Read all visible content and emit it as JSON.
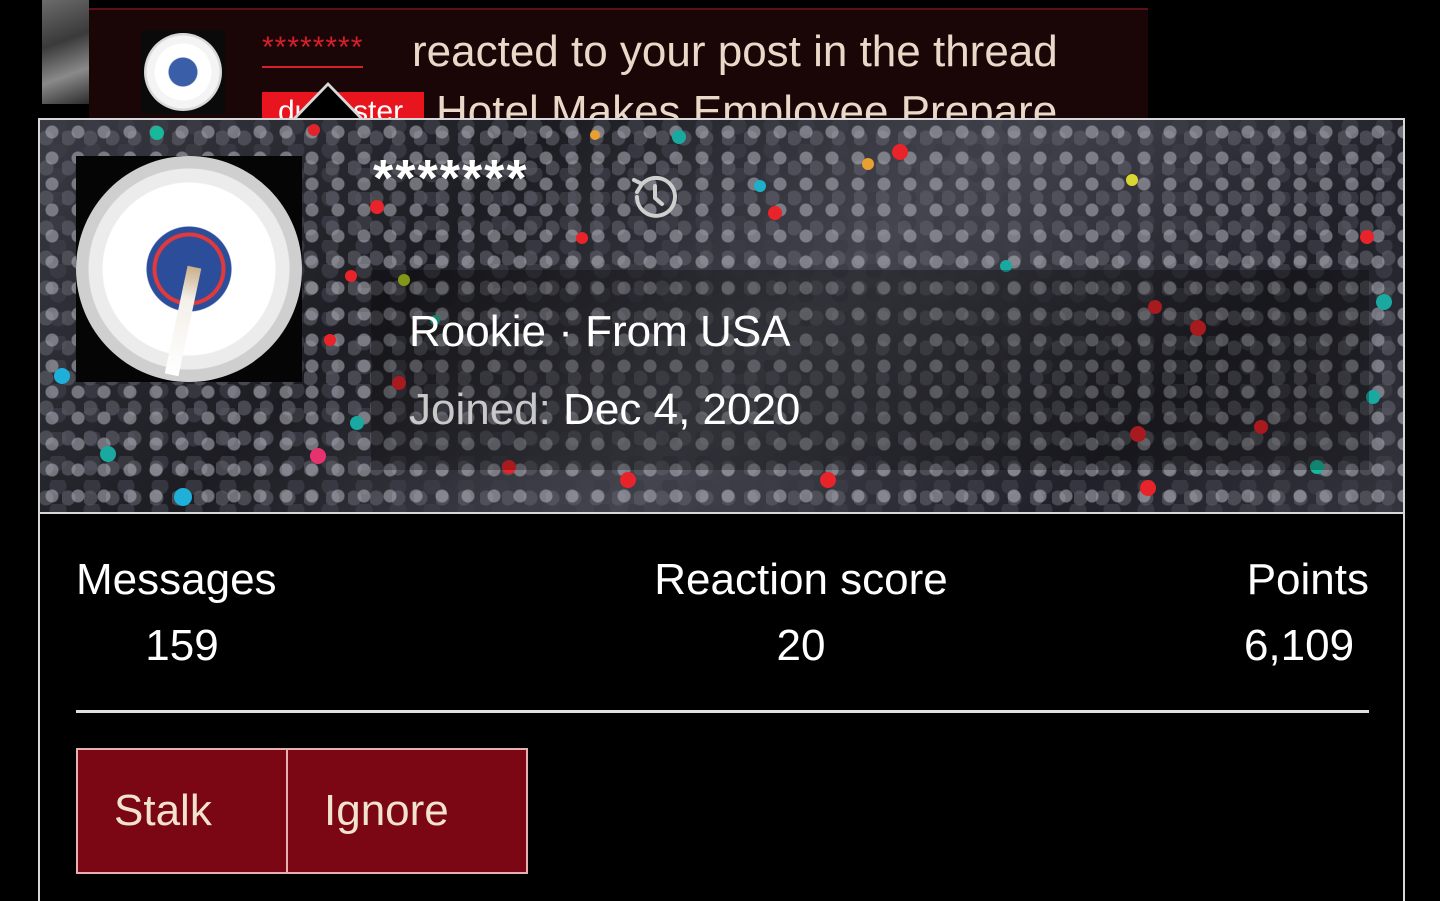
{
  "notification": {
    "username": "********",
    "text": "reacted to your post in the thread",
    "tag": "dumpster",
    "thread_title": "Hotel Makes Employee Prepare"
  },
  "profile": {
    "username": "*******",
    "title": "Rookie · From USA",
    "joined_label": "Joined:",
    "joined_value": "Dec 4, 2020",
    "history_icon": "history-icon"
  },
  "stats": {
    "messages_label": "Messages",
    "messages_value": "159",
    "reaction_label": "Reaction score",
    "reaction_value": "20",
    "points_label": "Points",
    "points_value": "6,109"
  },
  "actions": {
    "stalk_label": "Stalk",
    "ignore_label": "Ignore"
  },
  "colors": {
    "accent": "#7a0713",
    "username_red": "#d4202a",
    "text_cream": "#e8d9c8"
  }
}
